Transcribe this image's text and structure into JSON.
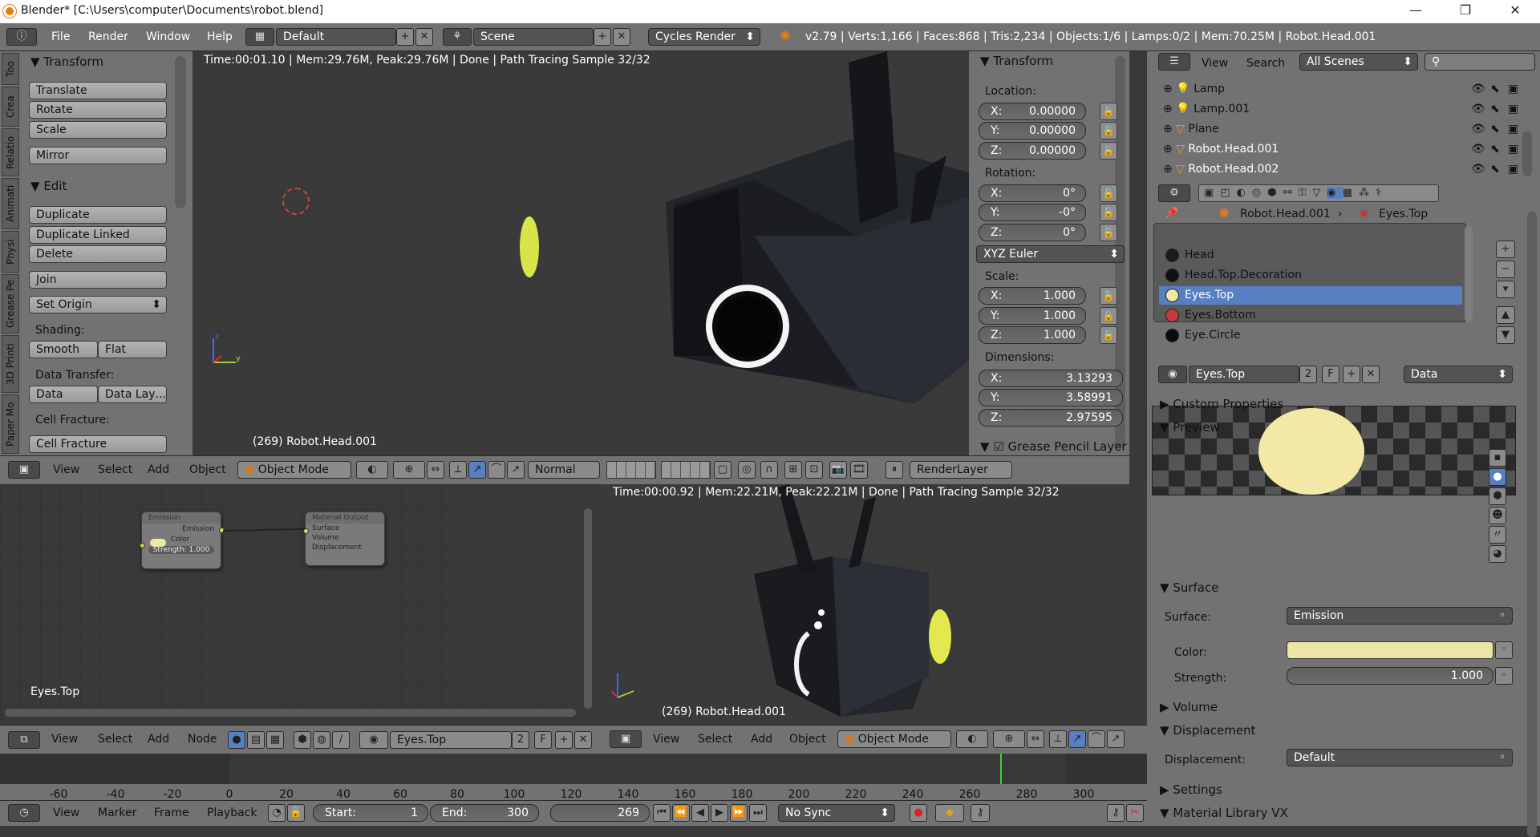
{
  "window": {
    "title": "Blender* [C:\\Users\\computer\\Documents\\robot.blend]",
    "min": "—",
    "max": "❐",
    "close": "✕"
  },
  "info": {
    "menus": [
      "File",
      "Render",
      "Window",
      "Help"
    ],
    "layout": "Default",
    "scene": "Scene",
    "engine": "Cycles Render",
    "stats": "v2.79 | Verts:1,166 | Faces:868 | Tris:2,234 | Objects:1/6 | Lamps:0/2 | Mem:70.25M | Robot.Head.001"
  },
  "toolshelf": {
    "tabs": [
      "Too",
      "Crea",
      "Relatio",
      "Animati",
      "Physi",
      "Grease Pe",
      "3D Printi",
      "Paper Mo"
    ],
    "transform_header": "Transform",
    "translate": "Translate",
    "rotate": "Rotate",
    "scale": "Scale",
    "mirror": "Mirror",
    "edit_header": "Edit",
    "duplicate": "Duplicate",
    "duplicate_linked": "Duplicate Linked",
    "delete": "Delete",
    "join": "Join",
    "set_origin": "Set Origin",
    "shading_label": "Shading:",
    "smooth": "Smooth",
    "flat": "Flat",
    "data_transfer_label": "Data Transfer:",
    "data": "Data",
    "data_layout": "Data Lay…",
    "cell_fracture_label": "Cell Fracture:",
    "cell_fracture": "Cell Fracture"
  },
  "viewport_top": {
    "status": "Time:00:01.10 | Mem:29.76M, Peak:29.76M | Done | Path Tracing Sample 32/32",
    "object_label": "(269) Robot.Head.001"
  },
  "nprops": {
    "header": "Transform",
    "location_label": "Location:",
    "loc": [
      {
        "k": "X:",
        "v": "0.00000"
      },
      {
        "k": "Y:",
        "v": "0.00000"
      },
      {
        "k": "Z:",
        "v": "0.00000"
      }
    ],
    "rotation_label": "Rotation:",
    "rot": [
      {
        "k": "X:",
        "v": "0°"
      },
      {
        "k": "Y:",
        "v": "-0°"
      },
      {
        "k": "Z:",
        "v": "0°"
      }
    ],
    "rotation_mode": "XYZ Euler",
    "scale_label": "Scale:",
    "scl": [
      {
        "k": "X:",
        "v": "1.000"
      },
      {
        "k": "Y:",
        "v": "1.000"
      },
      {
        "k": "Z:",
        "v": "1.000"
      }
    ],
    "dimensions_label": "Dimensions:",
    "dim": [
      {
        "k": "X:",
        "v": "3.13293"
      },
      {
        "k": "Y:",
        "v": "3.58991"
      },
      {
        "k": "Z:",
        "v": "2.97595"
      }
    ],
    "grease_pencil": "Grease Pencil Layer"
  },
  "view3d_header": {
    "menus": [
      "View",
      "Select",
      "Add",
      "Object"
    ],
    "mode": "Object Mode",
    "orientation": "Normal",
    "render_layer": "RenderLayer"
  },
  "node_editor": {
    "emission_node": {
      "title": "Emission",
      "out": "Emission",
      "color": "Color",
      "strength": "Strength: 1.000"
    },
    "output_node": {
      "title": "Material Output",
      "surface": "Surface",
      "volume": "Volume",
      "displacement": "Displacement"
    },
    "material_label": "Eyes.Top",
    "header_menus": [
      "View",
      "Select",
      "Add",
      "Node"
    ],
    "material": "Eyes.Top",
    "users": "2",
    "fake": "F"
  },
  "viewport_bottom": {
    "status": "Time:00:00.92 | Mem:22.21M, Peak:22.21M | Done | Path Tracing Sample 32/32",
    "object_label": "(269) Robot.Head.001",
    "menus": [
      "View",
      "Select",
      "Add",
      "Object"
    ],
    "mode": "Object Mode"
  },
  "timeline": {
    "ticks": [
      "-60",
      "-40",
      "-20",
      "0",
      "20",
      "40",
      "60",
      "80",
      "100",
      "120",
      "140",
      "160",
      "180",
      "200",
      "220",
      "240",
      "260",
      "280",
      "300"
    ],
    "current_frame_marker": 269,
    "menus": [
      "View",
      "Marker",
      "Frame",
      "Playback"
    ],
    "start_label": "Start:",
    "start": "1",
    "end_label": "End:",
    "end": "300",
    "frame": "269",
    "sync": "No Sync"
  },
  "outliner": {
    "menus": [
      "View",
      "Search"
    ],
    "filter": "All Scenes",
    "rows": [
      {
        "name": "Lamp",
        "icon": "lamp-icon"
      },
      {
        "name": "Lamp.001",
        "icon": "lamp-icon"
      },
      {
        "name": "Plane",
        "icon": "mesh-icon"
      },
      {
        "name": "Robot.Head.001",
        "icon": "mesh-icon"
      },
      {
        "name": "Robot.Head.002",
        "icon": "mesh-icon"
      }
    ]
  },
  "properties": {
    "breadcrumb_object": "Robot.Head.001",
    "breadcrumb_material": "Eyes.Top",
    "materials": [
      {
        "name": "Head",
        "color": "#1c1c1c"
      },
      {
        "name": "Head.Top.Decoration",
        "color": "#111111"
      },
      {
        "name": "Eyes.Top",
        "color": "#f1e7a4"
      },
      {
        "name": "Eyes.Bottom",
        "color": "#c83a3a"
      },
      {
        "name": "Eye.Circle",
        "color": "#0a0a0a"
      }
    ],
    "selected_material": "Eyes.Top",
    "users": "2",
    "fake": "F",
    "link": "Data",
    "custom_properties": "Custom Properties",
    "preview": "Preview",
    "surface_header": "Surface",
    "surface_label": "Surface:",
    "surface_value": "Emission",
    "color_label": "Color:",
    "color_value": "#ede5a6",
    "strength_label": "Strength:",
    "strength_value": "1.000",
    "volume": "Volume",
    "displacement_header": "Displacement",
    "displacement_label": "Displacement:",
    "displacement_value": "Default",
    "settings": "Settings",
    "material_library": "Material Library VX"
  }
}
